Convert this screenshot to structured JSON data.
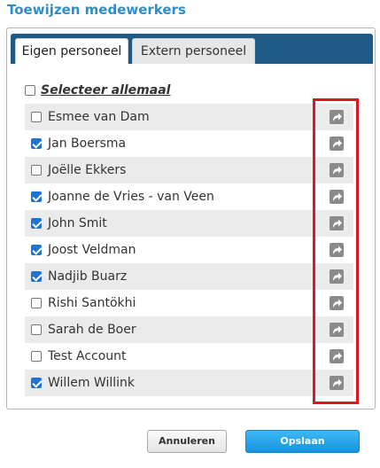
{
  "dialog": {
    "title": "Toewijzen medewerkers"
  },
  "tabs": [
    {
      "label": "Eigen personeel",
      "active": true
    },
    {
      "label": "Extern personeel",
      "active": false
    }
  ],
  "select_all": {
    "label": "Selecteer allemaal",
    "checked": false
  },
  "employees": [
    {
      "name": "Esmee van Dam",
      "checked": false
    },
    {
      "name": "Jan Boersma",
      "checked": true
    },
    {
      "name": "Joëlle Ekkers",
      "checked": false
    },
    {
      "name": "Joanne de Vries - van Veen",
      "checked": true
    },
    {
      "name": "John Smit",
      "checked": true
    },
    {
      "name": "Joost Veldman",
      "checked": true
    },
    {
      "name": "Nadjib Buarz",
      "checked": true
    },
    {
      "name": "Rishi Santökhi",
      "checked": false
    },
    {
      "name": "Sarah de Boer",
      "checked": false
    },
    {
      "name": "Test Account",
      "checked": false
    },
    {
      "name": "Willem Willink",
      "checked": true
    }
  ],
  "row_action_icon": "share-arrow-icon",
  "buttons": {
    "cancel_label": "Annuleren",
    "save_label": "Opslaan"
  },
  "colors": {
    "title": "#2f8ec4",
    "tabbar": "#1e5a85",
    "checkbox_checked": "#1f73d1",
    "highlight": "#e0161e",
    "save_button": "#1fa2ea"
  }
}
